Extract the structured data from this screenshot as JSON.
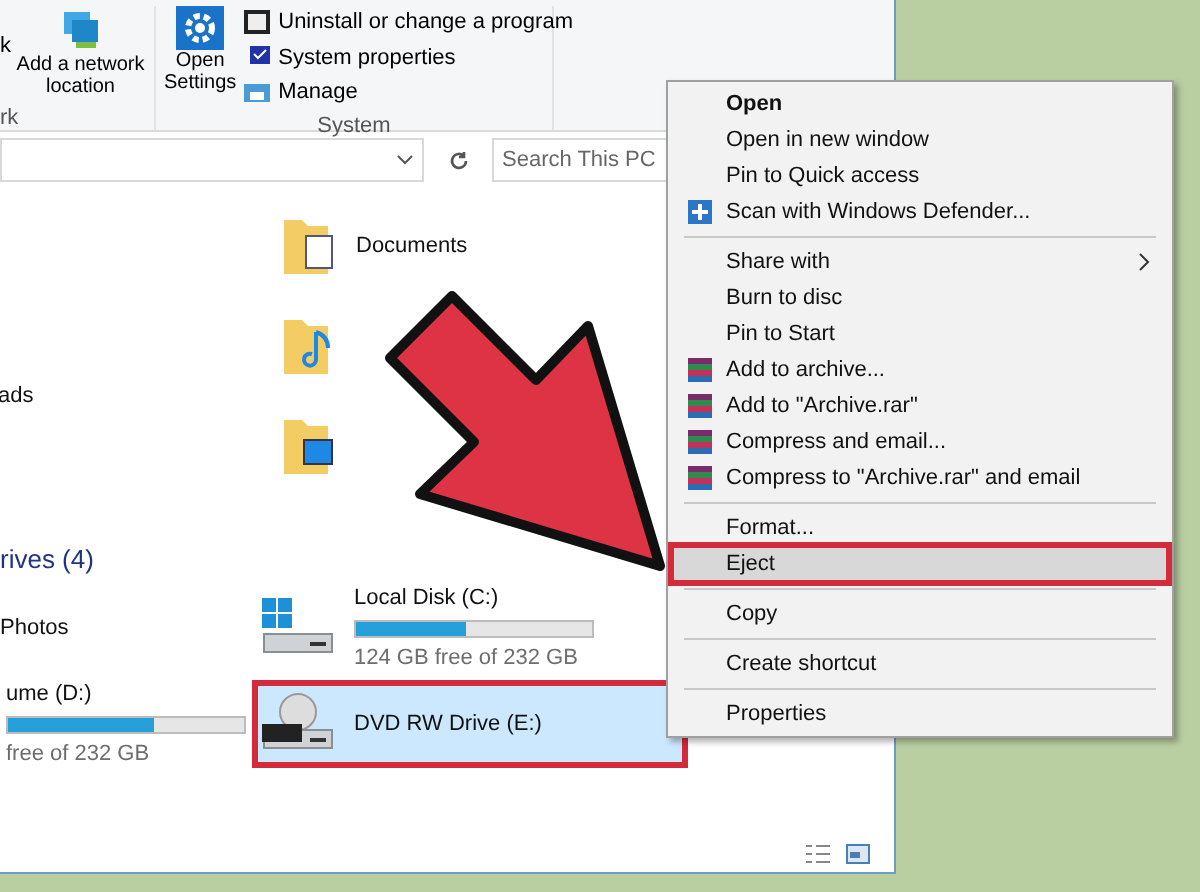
{
  "ribbon": {
    "cut_label": "k",
    "network_button": "Add a network location",
    "settings_button": "Open Settings",
    "system_items": [
      {
        "label": "Uninstall or change a program",
        "kind": "uninstall"
      },
      {
        "label": "System properties",
        "kind": "properties"
      },
      {
        "label": "Manage",
        "kind": "manage"
      }
    ],
    "group_labels": [
      "rk",
      "System"
    ]
  },
  "address_bar": {
    "search_placeholder": "Search This PC"
  },
  "nav_items": [
    "ads"
  ],
  "folders": [
    {
      "kind": "documents",
      "label": "Documents"
    },
    {
      "kind": "music"
    },
    {
      "kind": "videos"
    }
  ],
  "drives_header": "rives (4)",
  "items": [
    {
      "kind": "folder",
      "label": "Photos"
    },
    {
      "kind": "system_drive",
      "name": "Local Disk (C:)",
      "level": 0.47,
      "free": "124 GB free of 232 GB",
      "selected": false
    },
    {
      "kind": "disk_drive",
      "name": "ume (D:)",
      "level": 0.62,
      "free": "free of 232 GB",
      "selected": false
    },
    {
      "kind": "dvd_drive",
      "name": "DVD RW Drive (E:)",
      "selected": true
    }
  ],
  "context_menu": [
    {
      "kind": "item",
      "label": "Open",
      "bold": true,
      "selected": false
    },
    {
      "kind": "item",
      "label": "Open in new window",
      "selected": false
    },
    {
      "kind": "item",
      "label": "Pin to Quick access",
      "selected": false
    },
    {
      "kind": "shield_item",
      "label": "Scan with Windows Defender...",
      "selected": false
    },
    {
      "kind": "separator"
    },
    {
      "kind": "item",
      "label": "Share with",
      "submenu": true,
      "selected": false
    },
    {
      "kind": "item",
      "label": "Burn to disc",
      "selected": false
    },
    {
      "kind": "item",
      "label": "Pin to Start",
      "selected": false
    },
    {
      "kind": "archive_item",
      "label": "Add to archive...",
      "selected": false
    },
    {
      "kind": "archive_item",
      "label": "Add to \"Archive.rar\"",
      "selected": false
    },
    {
      "kind": "archive_item",
      "label": "Compress and email...",
      "selected": false
    },
    {
      "kind": "archive_item",
      "label": "Compress to \"Archive.rar\" and email",
      "selected": false
    },
    {
      "kind": "separator"
    },
    {
      "kind": "item",
      "label": "Format...",
      "selected": false
    },
    {
      "kind": "item",
      "label": "Eject",
      "selected": true
    },
    {
      "kind": "separator"
    },
    {
      "kind": "item",
      "label": "Copy",
      "selected": false
    },
    {
      "kind": "separator"
    },
    {
      "kind": "item",
      "label": "Create shortcut",
      "selected": false
    },
    {
      "kind": "separator"
    },
    {
      "kind": "item",
      "label": "Properties",
      "selected": false
    }
  ]
}
